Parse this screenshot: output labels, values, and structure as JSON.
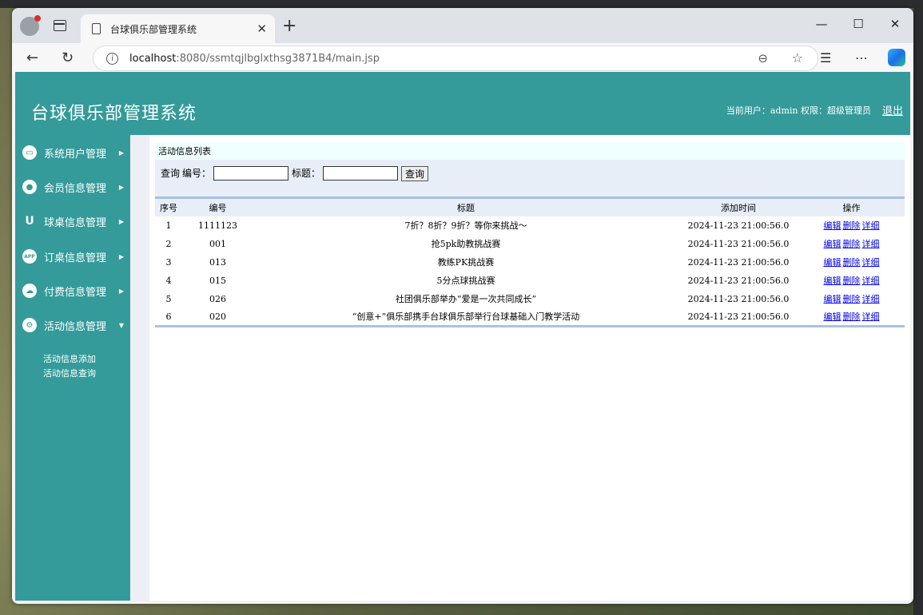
{
  "browser": {
    "tab_title": "台球俱乐部管理系统",
    "url_host": "localhost",
    "url_path": ":8080/ssmtqjlbglxthsg3871B4/main.jsp"
  },
  "app": {
    "title": "台球俱乐部管理系统",
    "user_label": "当前用户：",
    "user_name": "admin",
    "role_label": "权限：",
    "role_name": "超级管理员",
    "logout": "退出"
  },
  "sidebar": {
    "items": [
      {
        "label": "系统用户管理",
        "icon": "monitor-icon"
      },
      {
        "label": "会员信息管理",
        "icon": "user-gear-icon"
      },
      {
        "label": "球桌信息管理",
        "icon": "table-icon"
      },
      {
        "label": "订桌信息管理",
        "icon": "app-icon"
      },
      {
        "label": "付费信息管理",
        "icon": "cloud-icon"
      },
      {
        "label": "活动信息管理",
        "icon": "settings-icon"
      }
    ],
    "submenu": [
      "活动信息添加",
      "活动信息查询"
    ]
  },
  "content": {
    "list_title": "活动信息列表",
    "search": {
      "label_query": "查询",
      "label_id": "编号：",
      "label_title": "标题：",
      "button": "查询"
    },
    "table": {
      "headers": [
        "序号",
        "编号",
        "标题",
        "添加时间",
        "操作"
      ],
      "rows": [
        {
          "no": "1",
          "id": "1111123",
          "title": "7折？8折？9折？等你来挑战～",
          "time": "2024-11-23 21:00:56.0"
        },
        {
          "no": "2",
          "id": "001",
          "title": "抢5pk助教挑战赛",
          "time": "2024-11-23 21:00:56.0"
        },
        {
          "no": "3",
          "id": "013",
          "title": "教练PK挑战赛",
          "time": "2024-11-23 21:00:56.0"
        },
        {
          "no": "4",
          "id": "015",
          "title": "5分点球挑战赛",
          "time": "2024-11-23 21:00:56.0"
        },
        {
          "no": "5",
          "id": "026",
          "title": "社团俱乐部举办“爱是一次共同成长”",
          "time": "2024-11-23 21:00:56.0"
        },
        {
          "no": "6",
          "id": "020",
          "title": "“创意+”俱乐部携手台球俱乐部举行台球基础入门教学活动",
          "time": "2024-11-23 21:00:56.0"
        }
      ],
      "actions": [
        "编辑",
        "删除",
        "详细"
      ]
    }
  }
}
